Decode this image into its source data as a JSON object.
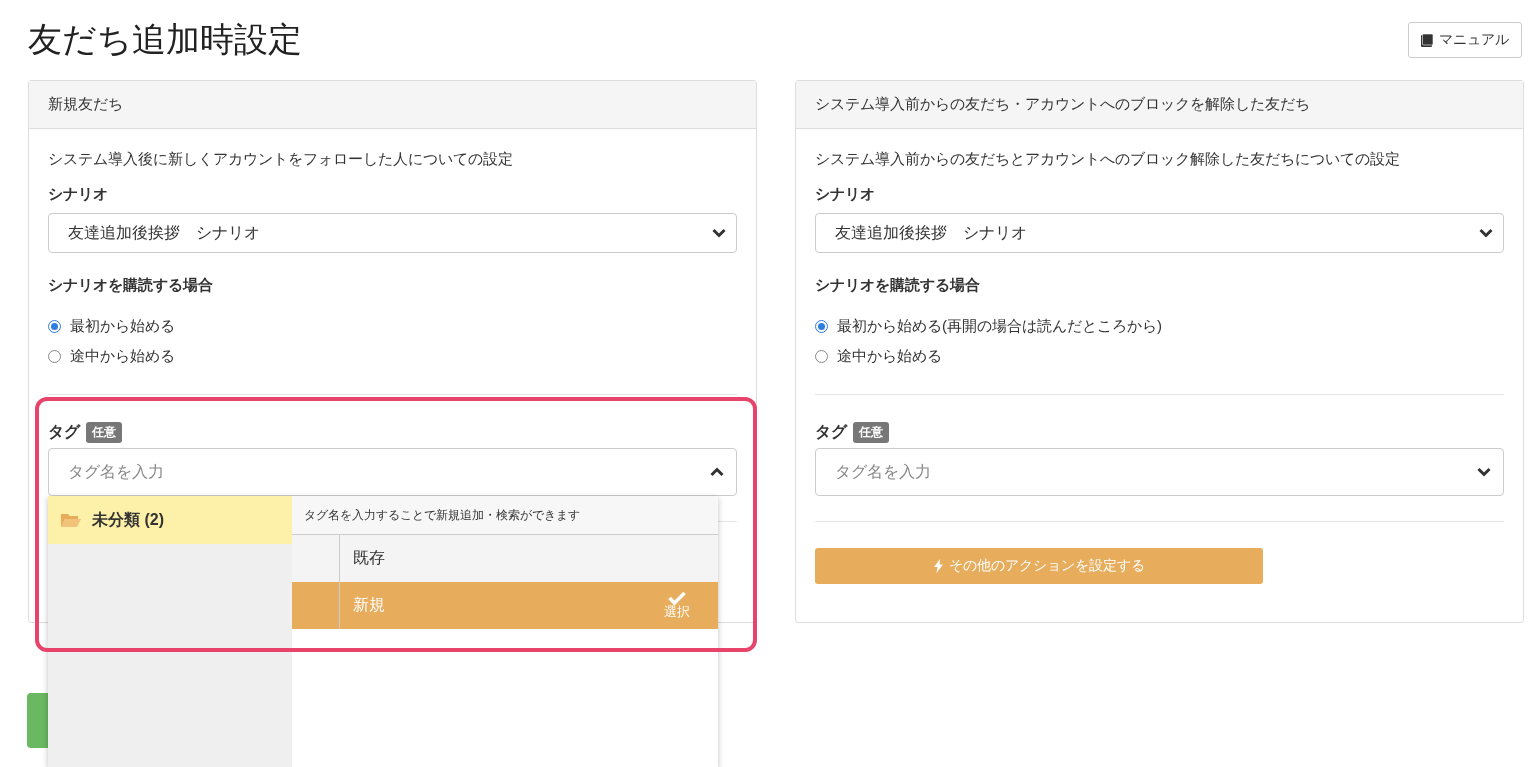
{
  "page": {
    "title": "友だち追加時設定",
    "manual_button": "マニュアル"
  },
  "panels": [
    {
      "header": "新規友だち",
      "description": "システム導入後に新しくアカウントをフォローした人についての設定",
      "scenario_label": "シナリオ",
      "scenario_value": "友達追加後挨拶　シナリオ",
      "subscribe_label": "シナリオを購読する場合",
      "radios": [
        {
          "label": "最初から始める",
          "selected": true
        },
        {
          "label": "途中から始める",
          "selected": false
        }
      ],
      "tag_label": "タグ",
      "tag_badge": "任意",
      "tag_placeholder": "タグ名を入力",
      "tag_expanded": true
    },
    {
      "header": "システム導入前からの友だち・アカウントへのブロックを解除した友だち",
      "description": "システム導入前からの友だちとアカウントへのブロック解除した友だちについての設定",
      "scenario_label": "シナリオ",
      "scenario_value": "友達追加後挨拶　シナリオ",
      "subscribe_label": "シナリオを購読する場合",
      "radios": [
        {
          "label": "最初から始める(再開の場合は読んだところから)",
          "selected": true
        },
        {
          "label": "途中から始める",
          "selected": false
        }
      ],
      "tag_label": "タグ",
      "tag_badge": "任意",
      "tag_placeholder": "タグ名を入力",
      "tag_expanded": false,
      "action_button": "その他のアクションを設定する"
    }
  ],
  "tag_dropdown": {
    "categories": [
      {
        "label": "未分類 (2)",
        "selected": true
      }
    ],
    "hint": "タグ名を入力することで新規追加・検索ができます",
    "select_label": "選択",
    "options": [
      {
        "label": "既存",
        "selected": false
      },
      {
        "label": "新規",
        "selected": true
      }
    ]
  }
}
